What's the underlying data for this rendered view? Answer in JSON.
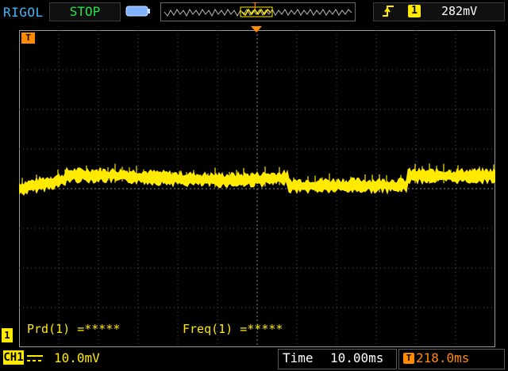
{
  "header": {
    "brand": "RIGOL",
    "run_state": "STOP",
    "battery_icon": "battery-icon",
    "timeline_trigger_marker": "T",
    "trigger": {
      "edge_icon": "rising-edge-icon",
      "source": "1",
      "level": "282mV"
    }
  },
  "display": {
    "trigger_marker_label": "T",
    "channel_marker_label": "1",
    "trace_color": "#ffea00",
    "grid_color": "#5a5a5a"
  },
  "measurements": [
    {
      "label": "Prd(1) =*****"
    },
    {
      "label": "Freq(1) =*****"
    }
  ],
  "footer": {
    "channel": "CH1",
    "coupling_icon": "dc-coupling-icon",
    "vertical_scale": "10.0mV",
    "time_label": "Time",
    "time_scale": "10.00ms",
    "trigger_offset_icon": "T",
    "trigger_offset": "218.0ms"
  }
}
